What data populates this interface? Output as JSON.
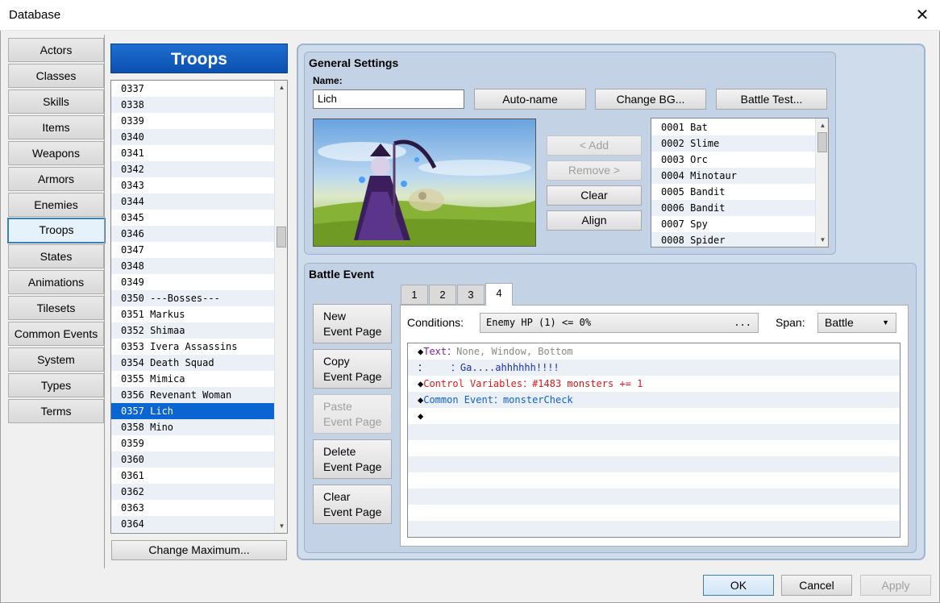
{
  "window": {
    "title": "Database",
    "close_glyph": "✕"
  },
  "categories": [
    {
      "label": "Actors"
    },
    {
      "label": "Classes"
    },
    {
      "label": "Skills"
    },
    {
      "label": "Items"
    },
    {
      "label": "Weapons"
    },
    {
      "label": "Armors"
    },
    {
      "label": "Enemies"
    },
    {
      "label": "Troops",
      "active": true
    },
    {
      "label": "States"
    },
    {
      "label": "Animations"
    },
    {
      "label": "Tilesets"
    },
    {
      "label": "Common Events"
    },
    {
      "label": "System"
    },
    {
      "label": "Types"
    },
    {
      "label": "Terms"
    }
  ],
  "troops": {
    "header": "Troops",
    "rows": [
      "0337",
      "0338",
      "0339",
      "0340",
      "0341",
      "0342",
      "0343",
      "0344",
      "0345",
      "0346",
      "0347",
      "0348",
      "0349",
      "0350 ---Bosses---",
      "0351 Markus",
      "0352 Shimaa",
      "0353 Ivera Assassins",
      "0354 Death Squad",
      "0355 Mimica",
      "0356 Revenant Woman",
      "0357 Lich",
      "0358 Mino",
      "0359",
      "0360",
      "0361",
      "0362",
      "0363",
      "0364"
    ],
    "selected_index": 20,
    "change_max_label": "Change Maximum..."
  },
  "general": {
    "title": "General Settings",
    "name_label": "Name:",
    "name_value": "Lich",
    "auto_name_label": "Auto-name",
    "change_bg_label": "Change BG...",
    "battle_test_label": "Battle Test...",
    "add_label": "< Add",
    "remove_label": "Remove >",
    "clear_label": "Clear",
    "align_label": "Align",
    "enemies": [
      "0001 Bat",
      "0002 Slime",
      "0003 Orc",
      "0004 Minotaur",
      "0005 Bandit",
      "0006 Bandit",
      "0007 Spy",
      "0008 Spider"
    ]
  },
  "battle_event": {
    "title": "Battle Event",
    "pages": [
      "1",
      "2",
      "3",
      "4"
    ],
    "active_page": "4",
    "new_page": [
      "New",
      "Event Page"
    ],
    "copy_page": [
      "Copy",
      "Event Page"
    ],
    "paste_page": [
      "Paste",
      "Event Page"
    ],
    "delete_page": [
      "Delete",
      "Event Page"
    ],
    "clear_page": [
      "Clear",
      "Event Page"
    ],
    "conditions_label": "Conditions:",
    "conditions_value": "Enemy HP (1) <= 0%",
    "conditions_dots": "...",
    "span_label": "Span:",
    "span_value": "Battle",
    "commands": [
      {
        "bullet": "◆",
        "name": "Text",
        "sep": "：",
        "args": "None, Window, Bottom"
      },
      {
        "bullet": "：",
        "name": "",
        "sep": "    ：",
        "args": "Ga....ahhhhhh!!!!"
      },
      {
        "bullet": "◆",
        "name": "Control Variables",
        "sep": "：",
        "args": "#1483 monsters += 1"
      },
      {
        "bullet": "◆",
        "name": "Common Event",
        "sep": "：",
        "args": "monsterCheck"
      },
      {
        "bullet": "◆",
        "name": "",
        "sep": "",
        "args": ""
      }
    ]
  },
  "footer": {
    "ok": "OK",
    "cancel": "Cancel",
    "apply": "Apply"
  },
  "colors": {
    "accent": "#0a64d2",
    "header": "#1d6fd1",
    "panel": "#c3d3e5"
  }
}
